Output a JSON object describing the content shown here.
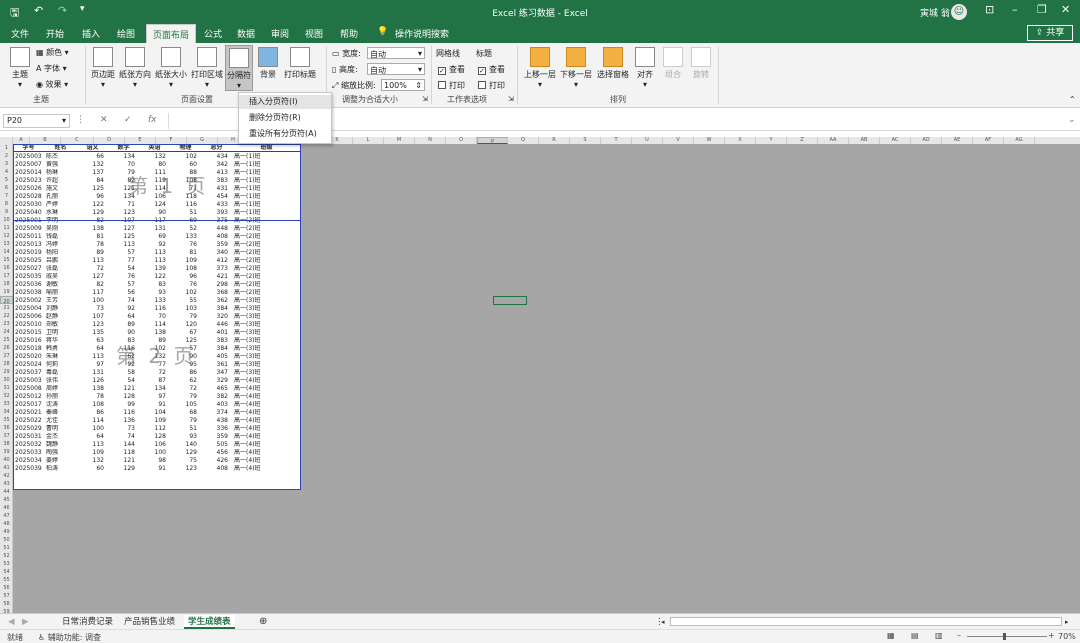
{
  "app": {
    "title": "Excel 练习数据 - Excel",
    "user": "寅城 翁",
    "autosave_icon": "save-icon",
    "undo_icon": "undo-icon",
    "redo_icon": "redo-icon"
  },
  "tabs": [
    "文件",
    "开始",
    "插入",
    "绘图",
    "页面布局",
    "公式",
    "数据",
    "审阅",
    "视图",
    "帮助"
  ],
  "active_tab": "页面布局",
  "tell_me": "操作说明搜索",
  "share": "共享",
  "ribbon": {
    "themes": {
      "theme": "主题",
      "colors": "颜色",
      "fonts": "字体",
      "effects": "效果",
      "label": "主题"
    },
    "page_setup": {
      "margins": "页边距",
      "orientation": "纸张方向",
      "size": "纸张大小",
      "print_area": "打印区域",
      "breaks": "分隔符",
      "background": "背景",
      "print_titles": "打印标题",
      "label": "页面设置"
    },
    "scale": {
      "width_label": "宽度:",
      "width_value": "自动",
      "height_label": "高度:",
      "height_value": "自动",
      "scale_label": "缩放比例:",
      "scale_value": "100%",
      "label": "调整为合适大小"
    },
    "sheet_options": {
      "gridlines": "网格线",
      "headings": "标题",
      "view": "查看",
      "print": "打印",
      "label": "工作表选项"
    },
    "arrange": {
      "bring_forward": "上移一层",
      "send_backward": "下移一层",
      "selection_pane": "选择窗格",
      "align": "对齐",
      "group": "组合",
      "rotate": "旋转",
      "label": "排列"
    }
  },
  "breaks_menu": [
    "插入分页符(I)",
    "删除分页符(R)",
    "重设所有分页符(A)"
  ],
  "name_box": "P20",
  "formula": "",
  "columns": [
    "A",
    "B",
    "C",
    "D",
    "E",
    "F",
    "G",
    "H",
    "I",
    "J",
    "K",
    "L",
    "M",
    "N",
    "O",
    "P",
    "Q",
    "R",
    "S",
    "T",
    "U",
    "V",
    "W",
    "X",
    "Y",
    "Z",
    "AA",
    "AB",
    "AC",
    "AD",
    "AE",
    "AF",
    "AG"
  ],
  "rows_visible": 60,
  "selected_cell": {
    "col": "P",
    "row": 20
  },
  "table_headers": [
    "学号",
    "姓名",
    "语文",
    "数学",
    "英语",
    "物理",
    "总分",
    "班级"
  ],
  "table_rows": [
    [
      "2025003",
      "陈杰",
      "66",
      "134",
      "132",
      "102",
      "434",
      "高一(1)班"
    ],
    [
      "2025007",
      "黄强",
      "132",
      "70",
      "80",
      "60",
      "342",
      "高一(1)班"
    ],
    [
      "2025014",
      "杨琳",
      "137",
      "79",
      "111",
      "88",
      "413",
      "高一(1)班"
    ],
    [
      "2025023",
      "许超",
      "84",
      "82",
      "119",
      "108",
      "383",
      "高一(1)班"
    ],
    [
      "2025026",
      "施文",
      "125",
      "121",
      "114",
      "71",
      "431",
      "高一(1)班"
    ],
    [
      "2025028",
      "孔丽",
      "96",
      "134",
      "106",
      "118",
      "454",
      "高一(1)班"
    ],
    [
      "2025030",
      "严婷",
      "122",
      "71",
      "124",
      "116",
      "433",
      "高一(1)班"
    ],
    [
      "2025040",
      "水琳",
      "129",
      "123",
      "90",
      "51",
      "393",
      "高一(1)班"
    ],
    [
      "2025001",
      "李明",
      "82",
      "107",
      "117",
      "69",
      "375",
      "高一(2)班"
    ],
    [
      "2025009",
      "吴刚",
      "138",
      "127",
      "131",
      "52",
      "448",
      "高一(2)班"
    ],
    [
      "2025011",
      "钱磊",
      "81",
      "125",
      "69",
      "133",
      "408",
      "高一(2)班"
    ],
    [
      "2025013",
      "冯婷",
      "78",
      "113",
      "92",
      "76",
      "359",
      "高一(2)班"
    ],
    [
      "2025019",
      "杨阳",
      "89",
      "57",
      "113",
      "81",
      "340",
      "高一(2)班"
    ],
    [
      "2025025",
      "吕鹏",
      "113",
      "77",
      "113",
      "109",
      "412",
      "高一(2)班"
    ],
    [
      "2025027",
      "张磊",
      "72",
      "54",
      "139",
      "108",
      "373",
      "高一(2)班"
    ],
    [
      "2025035",
      "戚吴",
      "127",
      "76",
      "122",
      "96",
      "421",
      "高一(2)班"
    ],
    [
      "2025036",
      "谢敏",
      "82",
      "57",
      "83",
      "76",
      "298",
      "高一(2)班"
    ],
    [
      "2025038",
      "喻丽",
      "117",
      "56",
      "93",
      "102",
      "368",
      "高一(2)班"
    ],
    [
      "2025002",
      "王芳",
      "100",
      "74",
      "133",
      "55",
      "362",
      "高一(3)班"
    ],
    [
      "2025004",
      "刘静",
      "73",
      "92",
      "116",
      "103",
      "384",
      "高一(3)班"
    ],
    [
      "2025006",
      "赵静",
      "107",
      "64",
      "70",
      "79",
      "320",
      "高一(3)班"
    ],
    [
      "2025010",
      "郑敏",
      "123",
      "89",
      "114",
      "120",
      "446",
      "高一(3)班"
    ],
    [
      "2025015",
      "卫明",
      "135",
      "90",
      "138",
      "67",
      "401",
      "高一(3)班"
    ],
    [
      "2025016",
      "蒋华",
      "63",
      "83",
      "89",
      "125",
      "383",
      "高一(3)班"
    ],
    [
      "2025018",
      "韩勇",
      "64",
      "116",
      "102",
      "57",
      "384",
      "高一(3)班"
    ],
    [
      "2025020",
      "朱琳",
      "113",
      "62",
      "132",
      "90",
      "405",
      "高一(3)班"
    ],
    [
      "2025024",
      "何莉",
      "97",
      "92",
      "77",
      "95",
      "361",
      "高一(3)班"
    ],
    [
      "2025037",
      "毒磊",
      "131",
      "58",
      "72",
      "86",
      "347",
      "高一(3)班"
    ],
    [
      "2025003",
      "张伟",
      "126",
      "54",
      "87",
      "62",
      "329",
      "高一(4)班"
    ],
    [
      "2025008",
      "周婷",
      "138",
      "121",
      "134",
      "72",
      "465",
      "高一(4)班"
    ],
    [
      "2025012",
      "孙丽",
      "78",
      "128",
      "97",
      "79",
      "382",
      "高一(4)班"
    ],
    [
      "2025017",
      "沈涛",
      "108",
      "99",
      "91",
      "105",
      "403",
      "高一(4)班"
    ],
    [
      "2025021",
      "秦峰",
      "86",
      "116",
      "104",
      "68",
      "374",
      "高一(4)班"
    ],
    [
      "2025022",
      "尤佳",
      "114",
      "136",
      "109",
      "79",
      "438",
      "高一(4)班"
    ],
    [
      "2025029",
      "曹明",
      "100",
      "73",
      "112",
      "51",
      "336",
      "高一(4)班"
    ],
    [
      "2025031",
      "金杰",
      "64",
      "74",
      "128",
      "93",
      "359",
      "高一(4)班"
    ],
    [
      "2025032",
      "魏静",
      "113",
      "144",
      "106",
      "140",
      "505",
      "高一(4)班"
    ],
    [
      "2025033",
      "陶强",
      "109",
      "118",
      "100",
      "129",
      "456",
      "高一(4)班"
    ],
    [
      "2025034",
      "姜婷",
      "132",
      "121",
      "98",
      "75",
      "426",
      "高一(4)班"
    ],
    [
      "2025039",
      "柏涛",
      "60",
      "129",
      "91",
      "123",
      "408",
      "高一(4)班"
    ]
  ],
  "watermarks": [
    "第 1 页",
    "第 2 页"
  ],
  "sheet_tabs": [
    "日常消费记录",
    "产品销售业绩",
    "学生成绩表"
  ],
  "active_sheet": "学生成绩表",
  "status": {
    "ready": "就绪",
    "accessibility": "辅助功能: 调查",
    "zoom": "70%"
  }
}
